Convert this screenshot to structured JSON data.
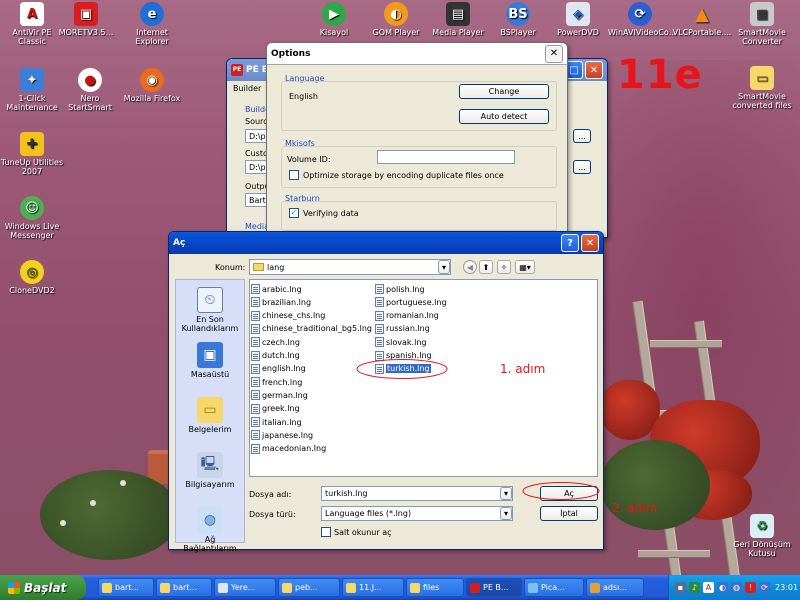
{
  "desktop": {
    "icons": [
      {
        "label": "AntiVir PE Classic"
      },
      {
        "label": "MORETV3.5..."
      },
      {
        "label": "Internet Explorer"
      },
      {
        "label": "1-Click Maintenance"
      },
      {
        "label": "Nero StartSmart"
      },
      {
        "label": "Mozilla Firefox"
      },
      {
        "label": "TuneUp Utilities 2007"
      },
      {
        "label": "Windows Live Messenger"
      },
      {
        "label": "CloneDVD2"
      },
      {
        "label": "Kisayol"
      },
      {
        "label": "GOM Player"
      },
      {
        "label": "Media Player"
      },
      {
        "label": "BSPlayer"
      },
      {
        "label": "PowerDVD"
      },
      {
        "label": "WinAVIVideoCo..."
      },
      {
        "label": "VLCPortable...."
      },
      {
        "label": "SmartMovie Converter"
      },
      {
        "label": "SmartMovie converted files"
      },
      {
        "label": "Geri Dönüşüm Kutusu"
      }
    ],
    "annotation_big": "11e",
    "annotation_step1": "1. adım",
    "annotation_step2": "2. adım"
  },
  "pe_window": {
    "title": "PE Bu",
    "menu_builder": "Builder",
    "builder_label": "Builde",
    "source_label": "Sourc",
    "source_value": "D:\\p",
    "custom_label": "Custo",
    "custom_value": "D:\\p",
    "output_label": "Outpu",
    "output_value": "Bart",
    "media_label": "Media",
    "browse": "..."
  },
  "options": {
    "title": "Options",
    "language_group": "Language",
    "language_value": "English",
    "change_button": "Change",
    "autodetect_button": "Auto detect",
    "mkisofs_group": "Mkisofs",
    "volume_label": "Volume ID:",
    "volume_value": "",
    "optimize_label": "Optimize storage by encoding duplicate files once",
    "starburn_group": "Starburn",
    "verify_label": "Verifying data"
  },
  "open_dialog": {
    "title": "Aç",
    "location_label": "Konum:",
    "location_value": "lang",
    "places": [
      {
        "label": "En Son Kullandıklarım"
      },
      {
        "label": "Masaüstü"
      },
      {
        "label": "Belgelerim"
      },
      {
        "label": "Bilgisayarım"
      },
      {
        "label": "Ağ Bağlantılarım"
      }
    ],
    "files_col1": [
      "arabic.lng",
      "brazilian.lng",
      "chinese_chs.lng",
      "chinese_traditional_bg5.lng",
      "czech.lng",
      "dutch.lng",
      "english.lng",
      "french.lng",
      "german.lng",
      "greek.lng",
      "italian.lng",
      "japanese.lng",
      "macedonian.lng"
    ],
    "files_col2": [
      "polish.lng",
      "portuguese.lng",
      "romanian.lng",
      "russian.lng",
      "slovak.lng",
      "spanish.lng",
      "turkish.lng"
    ],
    "selected_file": "turkish.lng",
    "filename_label": "Dosya adı:",
    "filename_value": "turkish.lng",
    "filetype_label": "Dosya türü:",
    "filetype_value": "Language files (*.lng)",
    "readonly_label": "Salt okunur aç",
    "open_button": "Aç",
    "cancel_button": "İptal"
  },
  "taskbar": {
    "start_label": "Başlat",
    "tasks": [
      {
        "label": "bart..."
      },
      {
        "label": "bart..."
      },
      {
        "label": "Yere..."
      },
      {
        "label": "peb..."
      },
      {
        "label": "11.J..."
      },
      {
        "label": "files"
      },
      {
        "label": "PE B..."
      },
      {
        "label": "Pica..."
      },
      {
        "label": "adsı..."
      }
    ],
    "clock": "23:01"
  },
  "colors": {
    "annotation_red": "#e8141c",
    "xp_blue": "#0a5fe3",
    "start_green": "#3a8e3a"
  }
}
